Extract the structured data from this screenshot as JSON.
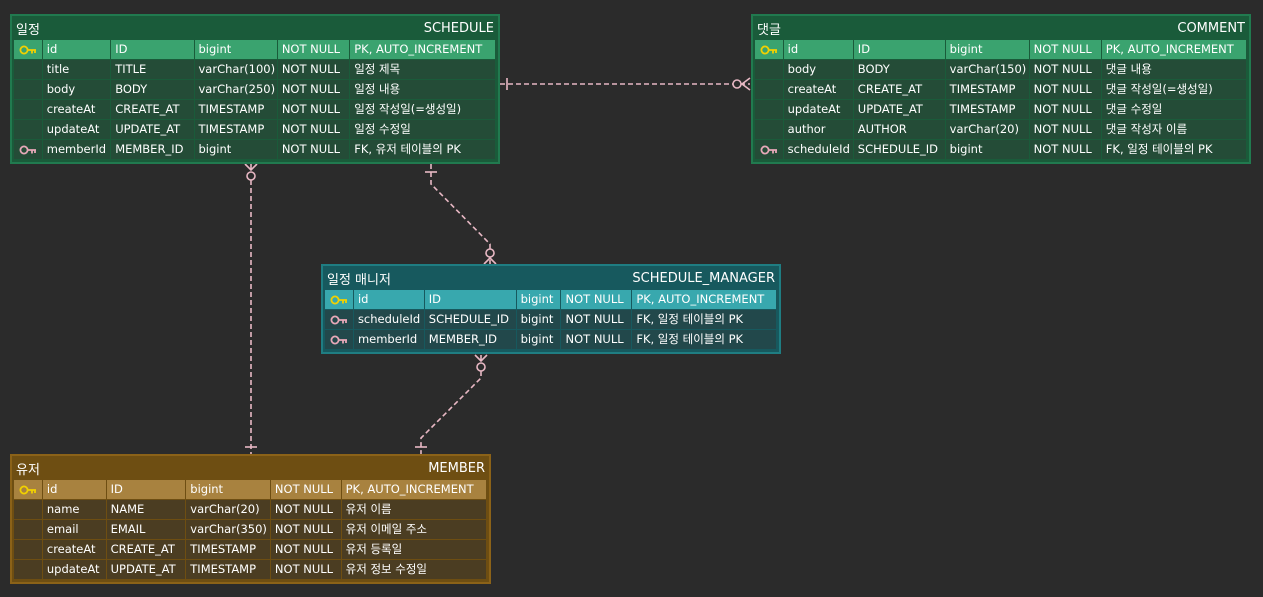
{
  "colors": {
    "background": "#2b2b2b",
    "link": "#e8b8c4",
    "pk_key": "#f2d100",
    "fk_key": "#e7a8b8"
  },
  "tables": {
    "schedule": {
      "title": "일정",
      "name": "SCHEDULE",
      "columns": [
        {
          "key": "pk",
          "field": "id",
          "column": "ID",
          "type": "bigint",
          "null": "NOT NULL",
          "note": "PK, AUTO_INCREMENT"
        },
        {
          "key": "",
          "field": "title",
          "column": "TITLE",
          "type": "varChar(100)",
          "null": "NOT NULL",
          "note": "일정 제목"
        },
        {
          "key": "",
          "field": "body",
          "column": "BODY",
          "type": "varChar(250)",
          "null": "NOT NULL",
          "note": "일정 내용"
        },
        {
          "key": "",
          "field": "createAt",
          "column": "CREATE_AT",
          "type": "TIMESTAMP",
          "null": "NOT NULL",
          "note": "일정 작성일(=생성일)"
        },
        {
          "key": "",
          "field": "updateAt",
          "column": "UPDATE_AT",
          "type": "TIMESTAMP",
          "null": "NOT NULL",
          "note": "일정 수정일"
        },
        {
          "key": "fk",
          "field": "memberId",
          "column": "MEMBER_ID",
          "type": "bigint",
          "null": "NOT NULL",
          "note": "FK, 유저 테이블의 PK"
        }
      ]
    },
    "comment": {
      "title": "댓글",
      "name": "COMMENT",
      "columns": [
        {
          "key": "pk",
          "field": "id",
          "column": "ID",
          "type": "bigint",
          "null": "NOT NULL",
          "note": "PK, AUTO_INCREMENT"
        },
        {
          "key": "",
          "field": "body",
          "column": "BODY",
          "type": "varChar(150)",
          "null": "NOT NULL",
          "note": "댓글 내용"
        },
        {
          "key": "",
          "field": "createAt",
          "column": "CREATE_AT",
          "type": "TIMESTAMP",
          "null": "NOT NULL",
          "note": "댓글 작성일(=생성일)"
        },
        {
          "key": "",
          "field": "updateAt",
          "column": "UPDATE_AT",
          "type": "TIMESTAMP",
          "null": "NOT NULL",
          "note": "댓글 수정일"
        },
        {
          "key": "",
          "field": "author",
          "column": "AUTHOR",
          "type": "varChar(20)",
          "null": "NOT NULL",
          "note": "댓글 작성자 이름"
        },
        {
          "key": "fk",
          "field": "scheduleId",
          "column": "SCHEDULE_ID",
          "type": "bigint",
          "null": "NOT NULL",
          "note": "FK, 일정 테이블의 PK"
        }
      ]
    },
    "manager": {
      "title": "일정 매니저",
      "name": "SCHEDULE_MANAGER",
      "columns": [
        {
          "key": "pk",
          "field": "id",
          "column": "ID",
          "type": "bigint",
          "null": "NOT NULL",
          "note": "PK, AUTO_INCREMENT"
        },
        {
          "key": "fk",
          "field": "scheduleId",
          "column": "SCHEDULE_ID",
          "type": "bigint",
          "null": "NOT NULL",
          "note": "FK, 일정 테이블의 PK"
        },
        {
          "key": "fk",
          "field": "memberId",
          "column": "MEMBER_ID",
          "type": "bigint",
          "null": "NOT NULL",
          "note": "FK, 일정 테이블의 PK"
        }
      ]
    },
    "member": {
      "title": "유저",
      "name": "MEMBER",
      "columns": [
        {
          "key": "pk",
          "field": "id",
          "column": "ID",
          "type": "bigint",
          "null": "NOT NULL",
          "note": "PK, AUTO_INCREMENT"
        },
        {
          "key": "",
          "field": "name",
          "column": "NAME",
          "type": "varChar(20)",
          "null": "NOT NULL",
          "note": "유저 이름"
        },
        {
          "key": "",
          "field": "email",
          "column": "EMAIL",
          "type": "varChar(350)",
          "null": "NOT NULL",
          "note": "유저 이메일 주소"
        },
        {
          "key": "",
          "field": "createAt",
          "column": "CREATE_AT",
          "type": "TIMESTAMP",
          "null": "NOT NULL",
          "note": "유저 등록일"
        },
        {
          "key": "",
          "field": "updateAt",
          "column": "UPDATE_AT",
          "type": "TIMESTAMP",
          "null": "NOT NULL",
          "note": "유저 정보 수정일"
        }
      ]
    }
  },
  "relationships": [
    {
      "from": "schedule",
      "to": "comment",
      "from_end": "one",
      "to_end": "zero-or-many"
    },
    {
      "from": "schedule",
      "to": "manager",
      "from_end": "one",
      "to_end": "zero-or-many"
    },
    {
      "from": "member",
      "to": "schedule",
      "from_end": "one",
      "to_end": "zero-or-many"
    },
    {
      "from": "member",
      "to": "manager",
      "from_end": "one",
      "to_end": "zero-or-many"
    }
  ]
}
